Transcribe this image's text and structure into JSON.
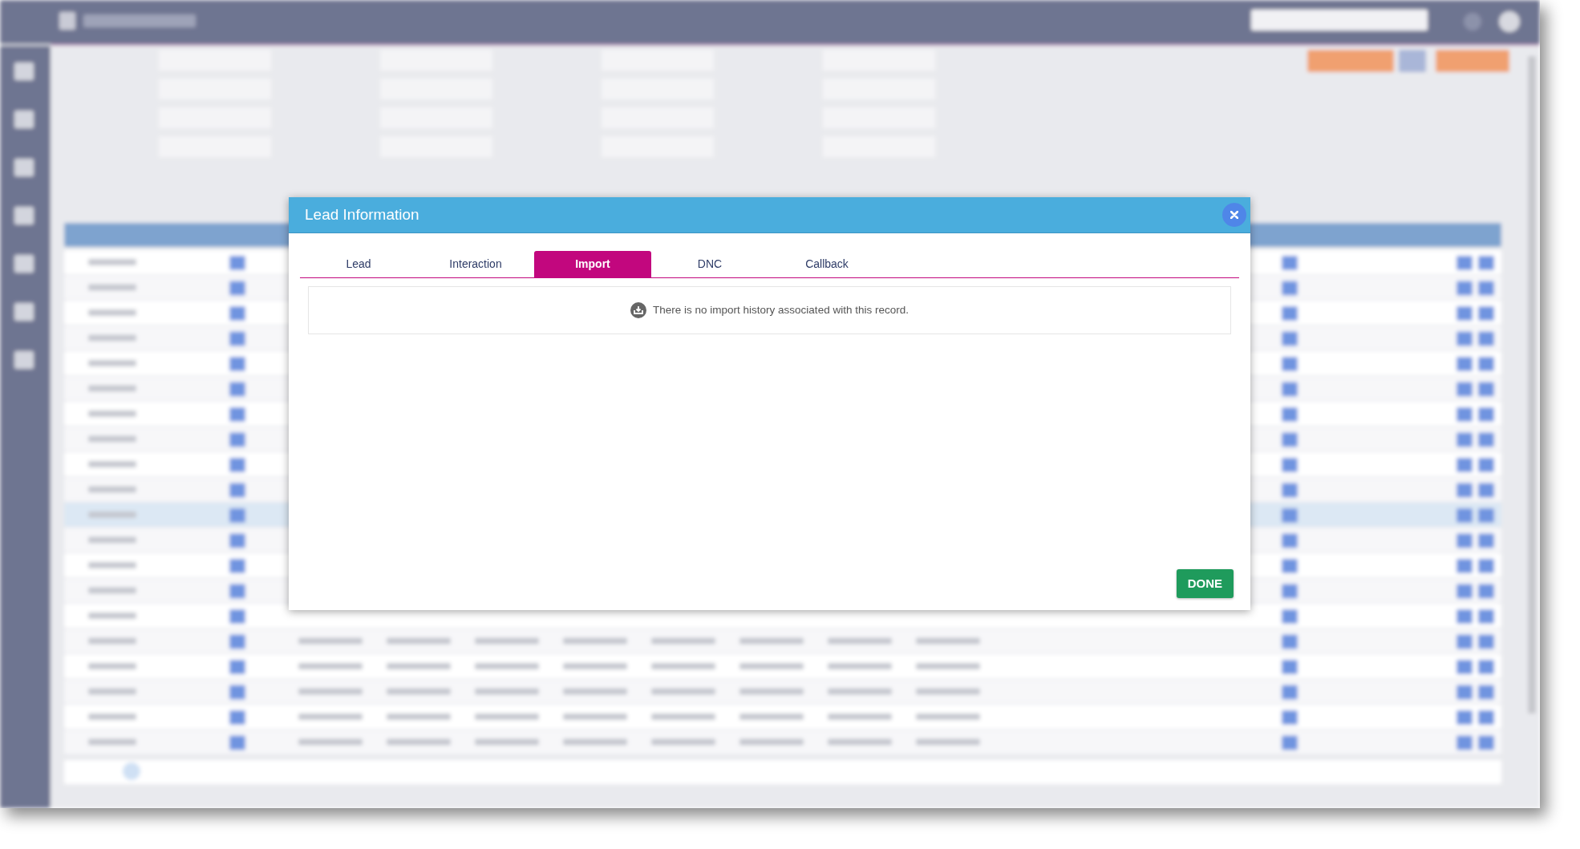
{
  "dialog": {
    "title": "Lead Information",
    "tabs": [
      {
        "label": "Lead",
        "selected": false
      },
      {
        "label": "Interaction",
        "selected": false
      },
      {
        "label": "Import",
        "selected": true
      },
      {
        "label": "DNC",
        "selected": false
      },
      {
        "label": "Callback",
        "selected": false
      }
    ],
    "message": "There is no import history associated with this record.",
    "buttons": [
      "DONE"
    ]
  }
}
